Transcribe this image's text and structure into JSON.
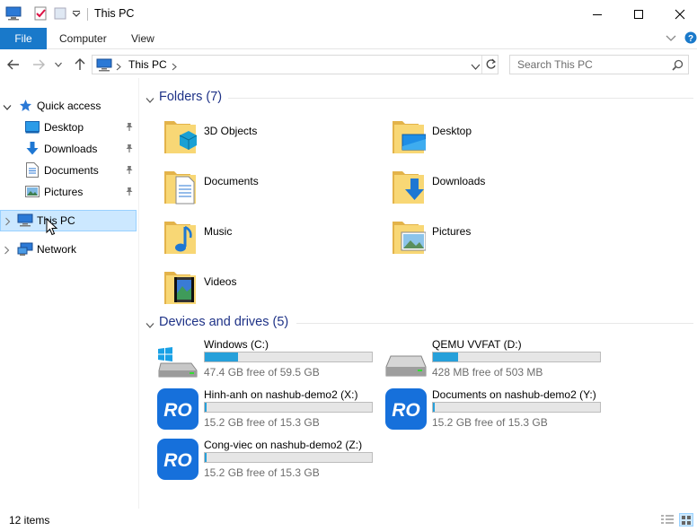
{
  "window": {
    "title": "This PC"
  },
  "ribbon": {
    "tabs": [
      {
        "label": "File"
      },
      {
        "label": "Computer"
      },
      {
        "label": "View"
      }
    ]
  },
  "address": {
    "path_segment": "This PC",
    "search_placeholder": "Search This PC"
  },
  "sidebar": {
    "quick_access": "Quick access",
    "quick_items": [
      {
        "label": "Desktop",
        "icon": "desktop-icon",
        "pinned": true
      },
      {
        "label": "Downloads",
        "icon": "downloads-icon",
        "pinned": true
      },
      {
        "label": "Documents",
        "icon": "documents-icon",
        "pinned": true
      },
      {
        "label": "Pictures",
        "icon": "pictures-icon",
        "pinned": true
      }
    ],
    "this_pc": "This PC",
    "network": "Network"
  },
  "folders": {
    "header": "Folders (7)",
    "items": [
      {
        "label": "3D Objects",
        "icon": "3d-objects-folder-icon"
      },
      {
        "label": "Desktop",
        "icon": "desktop-folder-icon"
      },
      {
        "label": "Documents",
        "icon": "documents-folder-icon"
      },
      {
        "label": "Downloads",
        "icon": "downloads-folder-icon"
      },
      {
        "label": "Music",
        "icon": "music-folder-icon"
      },
      {
        "label": "Pictures",
        "icon": "pictures-folder-icon"
      },
      {
        "label": "Videos",
        "icon": "videos-folder-icon"
      }
    ]
  },
  "drives": {
    "header": "Devices and drives (5)",
    "items": [
      {
        "name": "Windows (C:)",
        "free": "47.4 GB free of 59.5 GB",
        "used_fraction": 0.2,
        "icon": "windows-drive-icon"
      },
      {
        "name": "QEMU VVFAT (D:)",
        "free": "428 MB free of 503 MB",
        "used_fraction": 0.15,
        "icon": "hard-drive-icon"
      },
      {
        "name": "Hinh-anh on nashub-demo2 (X:)",
        "free": "15.2 GB free of 15.3 GB",
        "used_fraction": 0.01,
        "icon": "network-drive-icon"
      },
      {
        "name": "Documents on nashub-demo2 (Y:)",
        "free": "15.2 GB free of 15.3 GB",
        "used_fraction": 0.01,
        "icon": "network-drive-icon"
      },
      {
        "name": "Cong-viec on nashub-demo2 (Z:)",
        "free": "15.2 GB free of 15.3 GB",
        "used_fraction": 0.01,
        "icon": "network-drive-icon"
      }
    ],
    "network_drive_logo_text": "RO"
  },
  "status": {
    "items_count": "12 items"
  },
  "colors": {
    "accent": "#1979ca",
    "selection": "#cce8ff",
    "header_text": "#1e3287",
    "drive_fill": "#26a0da"
  }
}
